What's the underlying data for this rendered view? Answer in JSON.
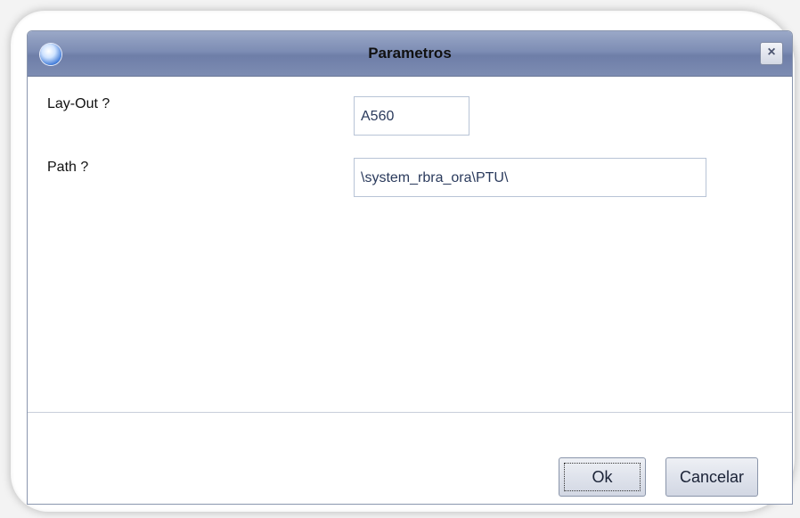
{
  "dialog": {
    "title": "Parametros",
    "close_glyph": "×",
    "icon": "app-globe-icon"
  },
  "fields": [
    {
      "label": "Lay-Out ?",
      "value": "A560"
    },
    {
      "label": "Path ?",
      "value": "\\system_rbra_ora\\PTU\\"
    }
  ],
  "buttons": {
    "ok_label": "Ok",
    "cancel_label": "Cancelar"
  },
  "colors": {
    "titlebar": "#7d8db4",
    "input_text": "#2a3a5c",
    "input_border": "#b8c4d6"
  }
}
